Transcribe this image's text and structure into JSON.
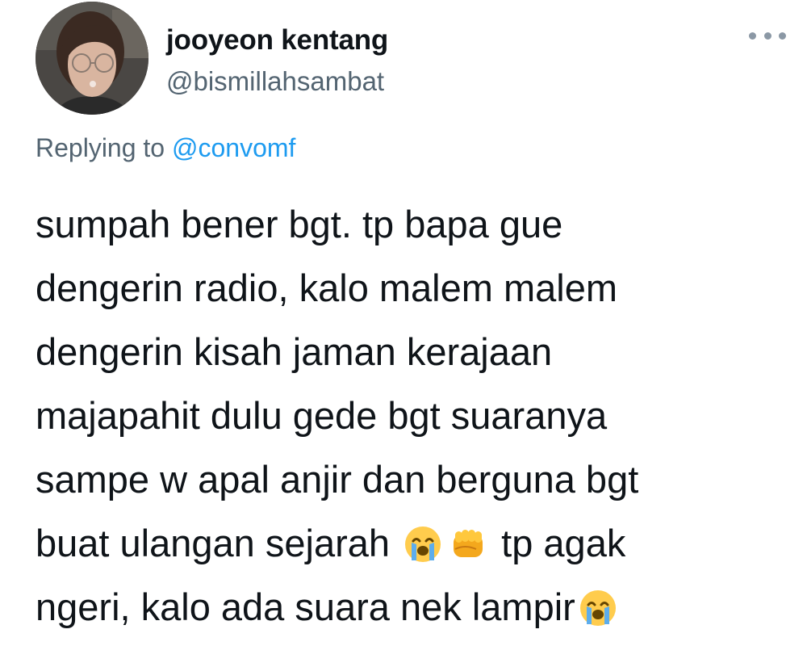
{
  "author": {
    "display_name": "jooyeon kentang",
    "handle": "@bismillahsambat"
  },
  "reply": {
    "prefix": "Replying to",
    "mention": "@convomf"
  },
  "tweet": {
    "line1": "sumpah bener bgt. tp bapa gue",
    "line2": "dengerin radio, kalo malem malem",
    "line3": "dengerin kisah jaman kerajaan",
    "line4": "majapahit dulu gede bgt suaranya",
    "line5": "sampe w apal anjir dan berguna bgt",
    "line6_start": "buat ulangan sejarah",
    "line6_end": "tp agak",
    "line7_start": "ngeri, kalo ada suara nek lampir",
    "emojis": [
      "loudly-crying-face",
      "oncoming-fist",
      "loudly-crying-face"
    ]
  },
  "icons": {
    "more": "more-options-icon"
  },
  "colors": {
    "text": "#0f1419",
    "secondary": "#536471",
    "link": "#1d9bf0"
  }
}
